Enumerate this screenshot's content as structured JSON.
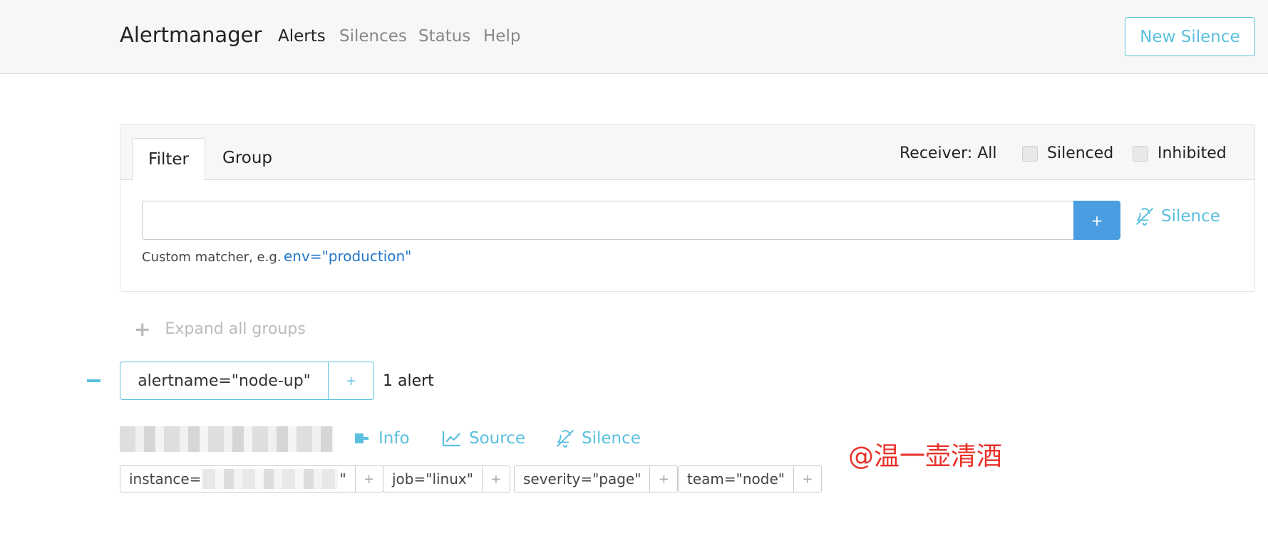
{
  "navbar": {
    "brand": "Alertmanager",
    "links": [
      "Alerts",
      "Silences",
      "Status",
      "Help"
    ],
    "new_silence": "New Silence"
  },
  "filter_card": {
    "tabs": [
      "Filter",
      "Group"
    ],
    "receiver": "Receiver: All",
    "silenced_label": "Silenced",
    "inhibited_label": "Inhibited",
    "input_value": "",
    "add_label": "+",
    "silence_label": "Silence",
    "hint": "Custom matcher, e.g.",
    "hint_example": "env=\"production\""
  },
  "expand": {
    "icon": "plus-icon",
    "label": "Expand all groups"
  },
  "group": {
    "label": "alertname=\"node-up\"",
    "plus": "+",
    "count": "1 alert"
  },
  "alert": {
    "actions": {
      "info": "Info",
      "source": "Source",
      "silence": "Silence"
    },
    "labels": [
      {
        "prefix": "instance=",
        "suffix": "\""
      },
      {
        "text": "job=\"linux\""
      },
      {
        "text": "severity=\"page\""
      },
      {
        "text": "team=\"node\""
      }
    ],
    "plus": "+"
  },
  "watermark": "@温一壶清酒",
  "colors": {
    "accent": "#5bc0de",
    "primary": "#4a9de0",
    "link": "#2277cc",
    "watermark": "#e8322a"
  }
}
